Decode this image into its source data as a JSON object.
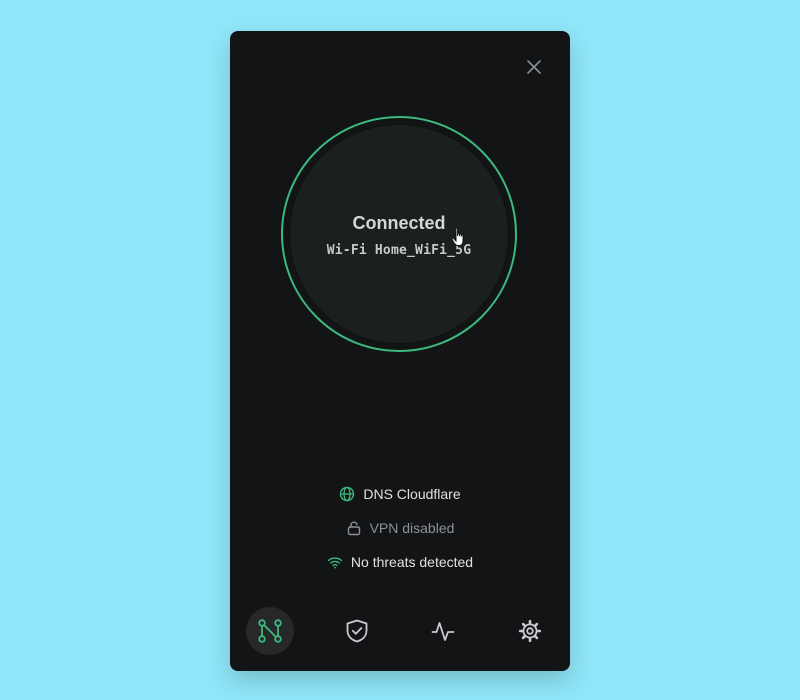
{
  "status": {
    "title": "Connected",
    "network": "Wi-Fi Home_WiFi_5G"
  },
  "info": [
    {
      "icon": "globe-icon",
      "label": "DNS Cloudflare",
      "color": "#dfe1e3"
    },
    {
      "icon": "lock-open-icon",
      "label": "VPN disabled",
      "color": "#8e9296"
    },
    {
      "icon": "wifi-icon",
      "label": "No threats detected",
      "color": "#dfe1e3"
    }
  ],
  "nav": [
    {
      "icon": "network-icon",
      "active": true
    },
    {
      "icon": "shield-check-icon",
      "active": false
    },
    {
      "icon": "activity-icon",
      "active": false
    },
    {
      "icon": "settings-gear-icon",
      "active": false
    }
  ],
  "colors": {
    "accent": "#3cb97c",
    "panel": "#131416",
    "background": "#8fe6f8"
  }
}
